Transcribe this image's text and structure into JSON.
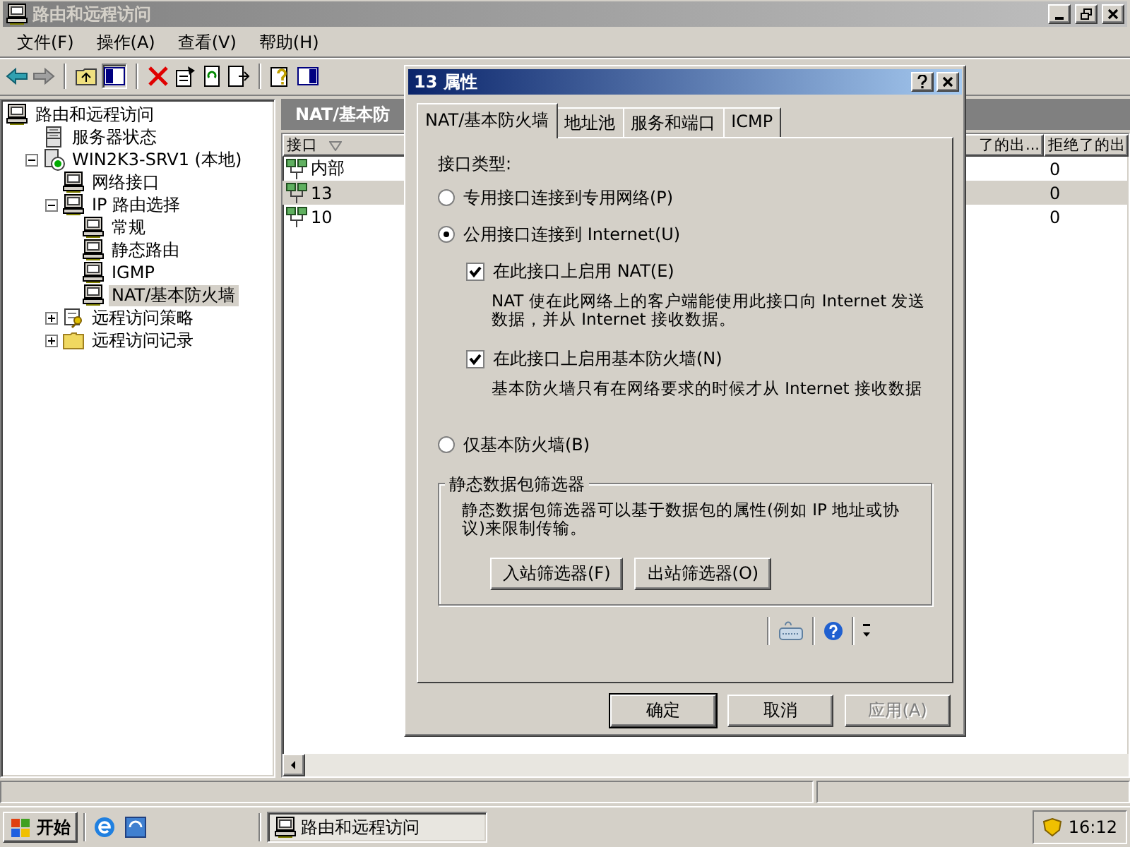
{
  "window": {
    "title": "路由和远程访问"
  },
  "menu": [
    "文件(F)",
    "操作(A)",
    "查看(V)",
    "帮助(H)"
  ],
  "tree": [
    {
      "label": "路由和远程访问",
      "kind": "computer",
      "selected": false,
      "children": [
        {
          "label": "服务器状态",
          "kind": "server",
          "selected": false
        },
        {
          "label": "WIN2K3-SRV1 (本地)",
          "kind": "host",
          "selected": false,
          "expanded": true,
          "children": [
            {
              "label": "网络接口",
              "kind": "computer",
              "selected": false
            },
            {
              "label": "IP 路由选择",
              "kind": "computer",
              "selected": false,
              "expanded": true,
              "children": [
                {
                  "label": "常规",
                  "kind": "computer",
                  "selected": false
                },
                {
                  "label": "静态路由",
                  "kind": "computer",
                  "selected": false
                },
                {
                  "label": "IGMP",
                  "kind": "computer",
                  "selected": false
                },
                {
                  "label": "NAT/基本防火墙",
                  "kind": "computer",
                  "selected": true
                }
              ]
            },
            {
              "label": "远程访问策略",
              "kind": "policy",
              "selected": false,
              "expanded": false
            },
            {
              "label": "远程访问记录",
              "kind": "folder",
              "selected": false,
              "expanded": false
            }
          ]
        }
      ]
    }
  ],
  "list": {
    "title": "NAT/基本防",
    "columns": [
      "接口",
      "了的出...",
      "拒绝了的出"
    ],
    "rows": [
      {
        "interface": "内部",
        "rejected": "0",
        "selected": false
      },
      {
        "interface": "13",
        "rejected": "0",
        "selected": true
      },
      {
        "interface": "10",
        "rejected": "0",
        "selected": false
      }
    ]
  },
  "dialog": {
    "title": "13 属性",
    "tabs": [
      {
        "label": "NAT/基本防火墙",
        "selected": true
      },
      {
        "label": "地址池",
        "selected": false
      },
      {
        "label": "服务和端口",
        "selected": false
      },
      {
        "label": "ICMP",
        "selected": false
      }
    ],
    "section_label": "接口类型:",
    "options": [
      {
        "kind": "radio",
        "label": "专用接口连接到专用网络(P)",
        "selected": false
      },
      {
        "kind": "radio",
        "label": "公用接口连接到 Internet(U)",
        "selected": true,
        "children": [
          {
            "kind": "checkbox",
            "label": "在此接口上启用 NAT(E)",
            "checked": true,
            "description": "NAT 使在此网络上的客户端能使用此接口向 Internet 发送数据，并从 Internet 接收数据。"
          },
          {
            "kind": "checkbox",
            "label": "在此接口上启用基本防火墙(N)",
            "checked": true,
            "description": "基本防火墙只有在网络要求的时候才从 Internet 接收数据"
          }
        ]
      },
      {
        "kind": "radio",
        "label": "仅基本防火墙(B)",
        "selected": false
      }
    ],
    "filters": {
      "title": "静态数据包筛选器",
      "description": "静态数据包筛选器可以基于数据包的属性(例如 IP 地址或协议)来限制传输。",
      "buttons": [
        "入站筛选器(F)",
        "出站筛选器(O)"
      ]
    },
    "buttons": [
      {
        "label": "确定",
        "default": true,
        "disabled": false
      },
      {
        "label": "取消",
        "default": false,
        "disabled": false
      },
      {
        "label": "应用(A)",
        "default": false,
        "disabled": true
      }
    ]
  },
  "taskbar": {
    "start": "开始",
    "tasks": [
      {
        "label": "路由和远程访问",
        "selected": true
      }
    ],
    "clock": "16:12"
  }
}
